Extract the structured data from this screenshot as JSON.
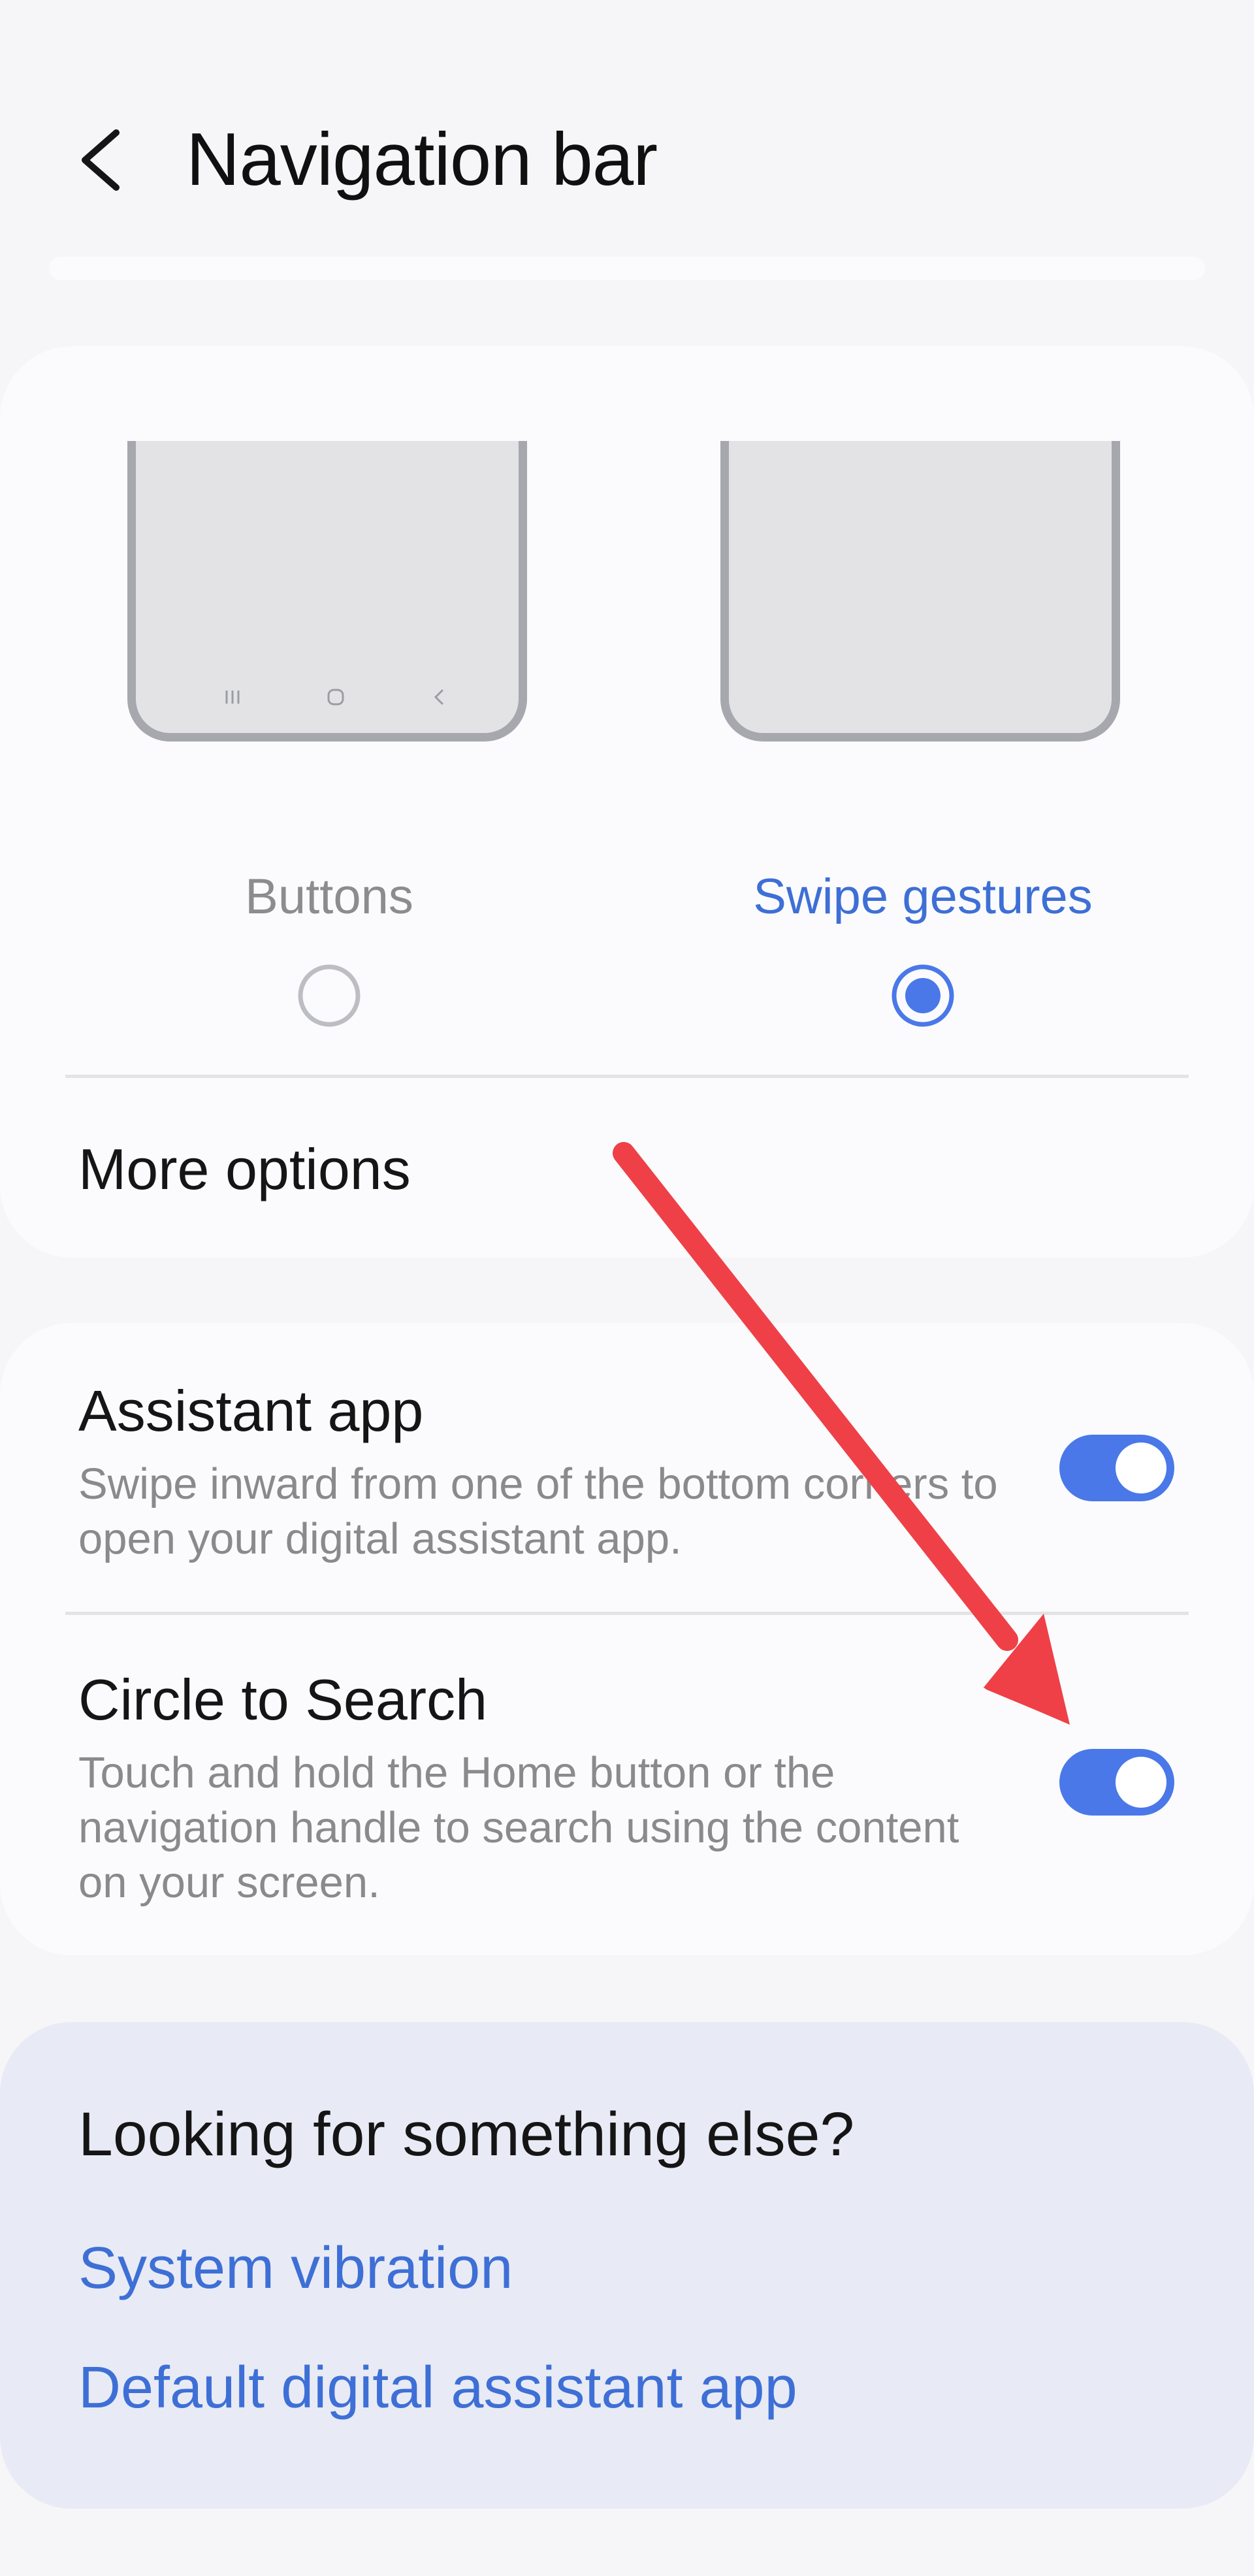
{
  "header": {
    "title": "Navigation bar",
    "back_icon": "chevron-left-icon"
  },
  "navigation_type": {
    "options": [
      {
        "label": "Buttons",
        "selected": false
      },
      {
        "label": "Swipe gestures",
        "selected": true
      }
    ],
    "more_options_label": "More options"
  },
  "gestures": {
    "items": [
      {
        "title": "Assistant app",
        "description": "Swipe inward from one of the bottom corners to open your digital assistant app.",
        "enabled": true
      },
      {
        "title": "Circle to Search",
        "description": "Touch and hold the Home button or the navigation handle to search using the content on your screen.",
        "enabled": true
      }
    ]
  },
  "suggestions": {
    "title": "Looking for something else?",
    "links": [
      "System vibration",
      "Default digital assistant app"
    ]
  },
  "colors": {
    "accent": "#3e6fd6",
    "toggle_on": "#4a78e8",
    "annotation_arrow": "#ef4047",
    "background": "#f6f6f8",
    "card": "#fbfbfd",
    "suggestion_card": "#e8ebf5"
  }
}
